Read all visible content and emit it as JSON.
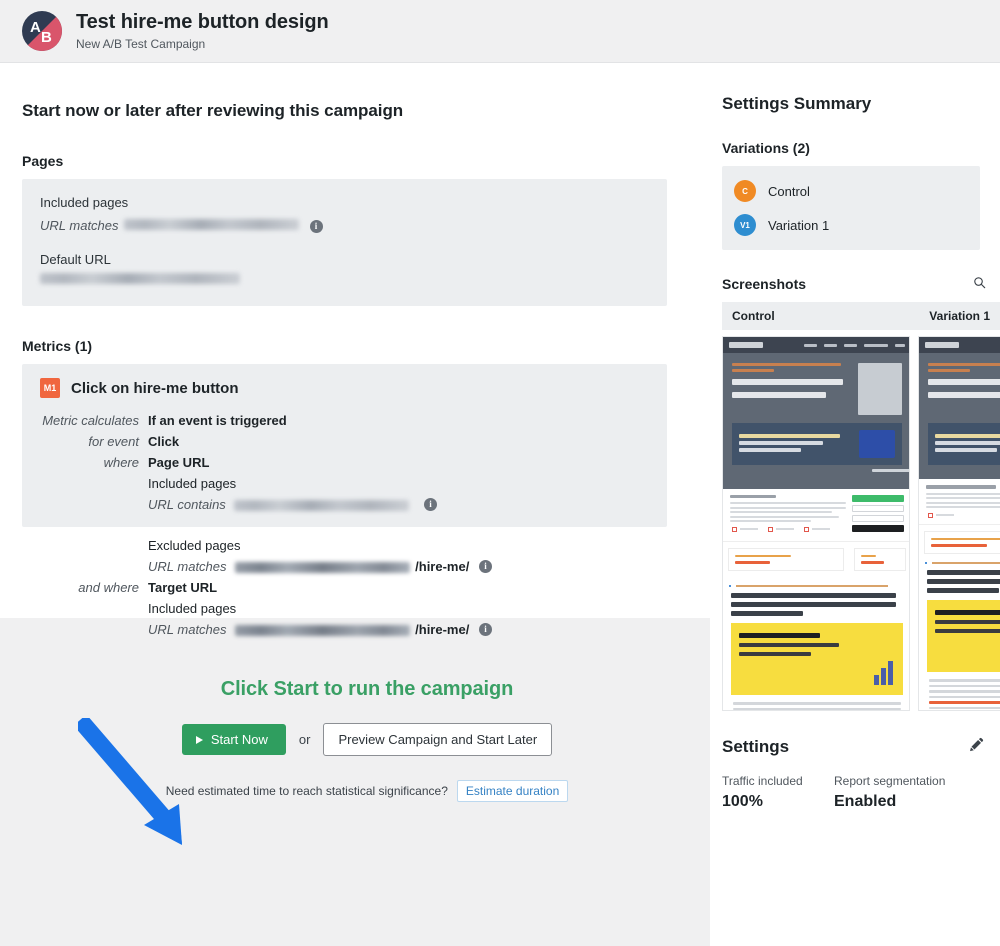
{
  "header": {
    "logo_letters": [
      "A",
      "B"
    ],
    "title": "Test hire-me button design",
    "subtitle": "New A/B Test Campaign"
  },
  "main": {
    "page_heading": "Start now or later after reviewing this campaign",
    "pages_section": {
      "heading": "Pages",
      "included_label": "Included pages",
      "url_matches_label": "URL matches",
      "url_matches_value": "[redacted url]",
      "default_url_label": "Default URL",
      "default_url_value": "[redacted url]"
    },
    "metrics_section": {
      "heading": "Metrics (1)",
      "badge": "M1",
      "metric_name": "Click on hire-me button",
      "rows": [
        {
          "label": "Metric calculates",
          "value": "If an event is triggered"
        },
        {
          "label": "for event",
          "value": "Click"
        },
        {
          "label": "where",
          "value": "Page URL"
        }
      ],
      "included_pages_label": "Included pages",
      "url_contains_label": "URL contains",
      "url_contains_value": "[redacted url]",
      "excluded_pages_label": "Excluded pages",
      "excluded_url_label": "URL matches",
      "excluded_url_suffix": "/hire-me/",
      "and_where_label": "and where",
      "target_url_value": "Target URL",
      "target_included_label": "Included pages",
      "target_url_matches_label": "URL matches",
      "target_url_suffix": "/hire-me/"
    },
    "cta": {
      "title": "Click Start to run the campaign",
      "start_button": "Start Now",
      "or_text": "or",
      "preview_button": "Preview Campaign and Start Later",
      "estimate_question": "Need estimated time to reach statistical significance?",
      "estimate_button": "Estimate duration"
    }
  },
  "sidebar": {
    "summary_heading": "Settings Summary",
    "variations_heading": "Variations (2)",
    "variations": [
      {
        "badge": "C",
        "label": "Control",
        "color": "#f08a24"
      },
      {
        "badge": "V1",
        "label": "Variation 1",
        "color": "#2e8dd0"
      }
    ],
    "screenshots_heading": "Screenshots",
    "screenshots_search_icon": "search-icon",
    "screenshot_columns": [
      "Control",
      "Variation 1"
    ],
    "settings": {
      "heading": "Settings",
      "edit_icon": "pencil-icon",
      "items": [
        {
          "label": "Traffic included",
          "value": "100%"
        },
        {
          "label": "Report segmentation",
          "value": "Enabled"
        }
      ]
    }
  },
  "annotation": {
    "arrow_color": "#1a73e8",
    "points_to": "Start Now"
  },
  "colors": {
    "accent_green": "#2f9e5f",
    "cta_title_green": "#3aa065",
    "metric_badge_orange": "#f0663f",
    "link_blue": "#3582c4",
    "card_gray": "#eceef0",
    "page_gray": "#f0f0f1"
  }
}
